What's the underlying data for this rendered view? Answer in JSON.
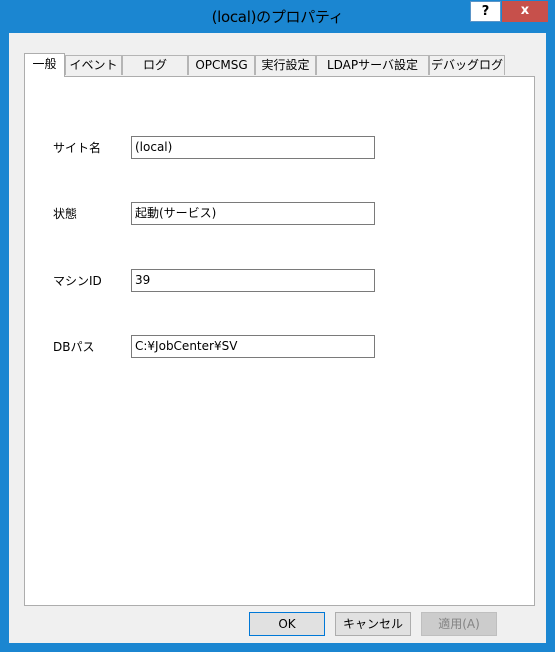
{
  "window": {
    "title": "(local)のプロパティ",
    "help_label": "?",
    "close_label": "x"
  },
  "tabs": [
    {
      "label": "一般",
      "active": true
    },
    {
      "label": "イベント",
      "active": false
    },
    {
      "label": "ログ",
      "active": false
    },
    {
      "label": "OPCMSG",
      "active": false
    },
    {
      "label": "実行設定",
      "active": false
    },
    {
      "label": "LDAPサーバ設定",
      "active": false
    },
    {
      "label": "デバッグログ",
      "active": false
    }
  ],
  "fields": {
    "site_name": {
      "label": "サイト名",
      "value": "(local)"
    },
    "status": {
      "label": "状態",
      "value": "起動(サービス)"
    },
    "machine_id": {
      "label": "マシンID",
      "value": "39"
    },
    "db_path": {
      "label": "DBパス",
      "value": "C:¥JobCenter¥SV"
    }
  },
  "buttons": {
    "ok": "OK",
    "cancel": "キャンセル",
    "apply": "適用(A)"
  },
  "colors": {
    "title_bar": "#1b86d1",
    "close_button": "#c7504b",
    "dialog_bg": "#f0f0f0"
  }
}
